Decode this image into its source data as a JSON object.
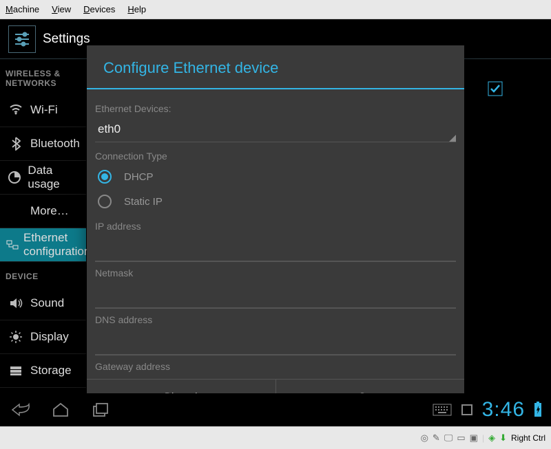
{
  "host_menu": {
    "machine": "Machine",
    "view": "View",
    "devices": "Devices",
    "help": "Help"
  },
  "action_bar": {
    "title": "Settings"
  },
  "sections": {
    "wireless": "WIRELESS & NETWORKS",
    "device": "DEVICE"
  },
  "items": {
    "wifi": "Wi-Fi",
    "bluetooth": "Bluetooth",
    "data": "Data usage",
    "more": "More…",
    "ethernet": "Ethernet configuration",
    "sound": "Sound",
    "display": "Display",
    "storage": "Storage"
  },
  "dialog": {
    "title": "Configure Ethernet device",
    "eth_devices_label": "Ethernet Devices:",
    "eth_device_value": "eth0",
    "conn_type_label": "Connection Type",
    "dhcp": "DHCP",
    "static_ip": "Static IP",
    "ip_label": "IP address",
    "netmask_label": "Netmask",
    "dns_label": "DNS address",
    "gateway_label": "Gateway address",
    "discard": "Discard",
    "save": "Save"
  },
  "status": {
    "time": "3:46"
  },
  "host_status": {
    "key": "Right Ctrl"
  }
}
